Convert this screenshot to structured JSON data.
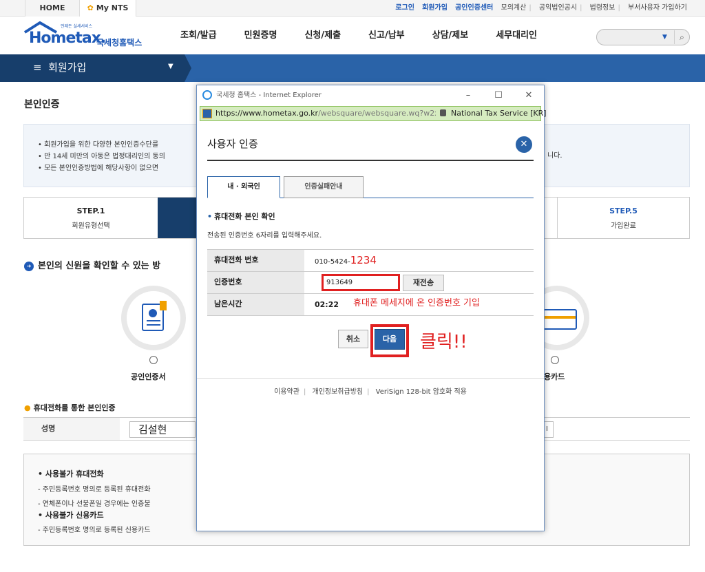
{
  "topbar": {
    "home": "HOME",
    "mynts": "My NTS",
    "links": [
      "로그인",
      "회원가입",
      "공인인증센터",
      "모의계산",
      "공익법인공시",
      "법령정보",
      "부서사용자 가입하기"
    ]
  },
  "header": {
    "logo_tag": "언제든 실세서비스",
    "logo_word": "Hometax.",
    "logo_kor": "국세청홈택스",
    "nav": [
      "조회/발급",
      "민원증명",
      "신청/제출",
      "신고/납부",
      "상담/제보",
      "세무대리인"
    ]
  },
  "menubar": {
    "label": "회원가입"
  },
  "page": {
    "title": "본인인증",
    "info_lines": [
      "회원가입을 위한 다양한 본인인증수단를",
      "만 14세 미만의 아동은 법정대리인의 동의",
      "모든 본인인증방법에 해당사항이 없으면"
    ],
    "info_tail": "니다.",
    "steps": [
      {
        "num": "STEP.1",
        "label": "회원유형선택"
      },
      {
        "num": "STEP.5",
        "label": "가입완료"
      }
    ],
    "section_title": "본인의 신원을 확인할 수 있는 방",
    "option_cert": "공인인증서",
    "option_card": "용카드",
    "phone_title": "휴대전화를 통한 본인인증",
    "name_label": "성명",
    "name_value": "김설현",
    "name_right": "I",
    "notes": [
      "사용불가 휴대전화",
      "- 주민등록번호 명의로 등록된 휴대전화",
      "- 연체폰이나 선불폰일 경우에는 인증불",
      "사용불가 신용카드",
      "- 주민등록번호 명의로 등록된 신용카드"
    ]
  },
  "popup": {
    "window_title": "국세청 홈택스 - Internet Explorer",
    "url_main": "https://www.hometax.go.kr",
    "url_rest": "/websquare/websquare.wq?w2xPa",
    "cert_name": "National Tax Service [KR]",
    "title": "사용자 인증",
    "tabs": [
      "내 · 외국인",
      "인증실패안내"
    ],
    "sub_title": "휴대전화 본인 확인",
    "instruction": "전송된 인증번호 6자리를 입력해주세요.",
    "phone_label": "휴대전화 번호",
    "phone_prefix": "010-5424-",
    "phone_suffix": "1234",
    "code_label": "인증번호",
    "code_value": "913649",
    "resend_label": "재전송",
    "time_label": "남은시간",
    "time_value": "02:22",
    "code_annotation": "휴대폰 메세지에 온 인증번호 기입",
    "cancel_label": "취소",
    "next_label": "다음",
    "click_annotation": "클릭!!",
    "footer_links": [
      "이용약관",
      "개인정보취급방침",
      "VeriSign 128-bit 암호화 적용"
    ]
  },
  "colors": {
    "brand_blue": "#2a63a8",
    "dark_navy": "#173e6b",
    "highlight_red": "#e02020"
  }
}
